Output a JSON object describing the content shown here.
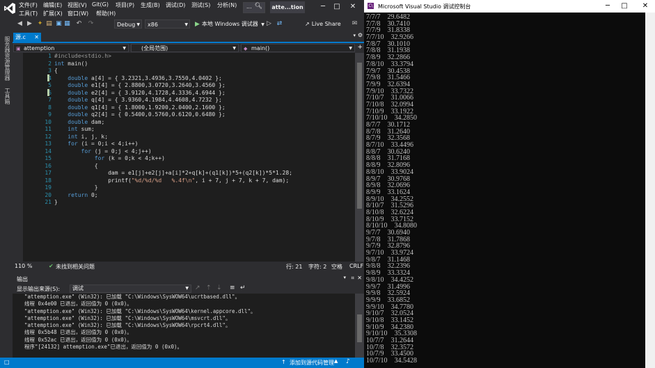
{
  "vs": {
    "menu_row1": [
      "文件(F)",
      "编辑(E)",
      "视图(V)",
      "Git(G)",
      "项目(P)",
      "生成(B)",
      "调试(D)",
      "测试(S)",
      "分析(N)"
    ],
    "menu_row2": [
      "工具(T)",
      "扩展(X)",
      "窗口(W)",
      "帮助(H)"
    ],
    "search_label": "...",
    "title": "atte...tion",
    "toolbar": {
      "config": "Debug",
      "platform": "x86",
      "run_label": "本地 Windows 调试器",
      "live_share": "Live Share"
    },
    "side_tabs": [
      "服务器资源管理器",
      "工具箱"
    ],
    "file_tab": "源.c",
    "nav": {
      "project": "attemption",
      "scope": "(全局范围)",
      "function": "main()"
    },
    "code_lines": [
      "#include<stdio.h>",
      "int main()",
      "{",
      "    double a[4] = { 3.2321,3.4936,3.7550,4.0402 };",
      "    double e1[4] = { 2.8800,3.0720,3.2640,3.4560 };",
      "    double e2[4] = { 3.9120,4.1728,4.3336,4.6944 };",
      "    double q[4] = { 3.9360,4.1984,4.4608,4.7232 };",
      "    double q1[4] = { 1.8000,1.9200,2.0400,2.1600 };",
      "    double q2[4] = { 0.5400,0.5760,0.6120,0.6480 };",
      "    double dam;",
      "    int sum;",
      "    int i, j, k;",
      "    for (i = 0;i < 4;i++)",
      "        for (j = 0;j < 4;j++)",
      "            for (k = 0;k < 4;k++)",
      "            {",
      "                dam = e1[j]+e2[j]+a[i]*2+q[k]+(q1[k])*5+(q2[k])*5*1.28;",
      "                printf(\"%d/%d/%d   %.4f\\n\", i + 7, j + 7, k + 7, dam);",
      "            }",
      "    return 0;",
      "}"
    ],
    "status": {
      "zoom": "110 %",
      "issues": "未找到相关问题",
      "line": "行: 21",
      "char": "字符: 2",
      "ws": "空格",
      "eol": "CRLF"
    },
    "output": {
      "title": "输出",
      "source_label": "显示输出来源(S):",
      "source_value": "调试",
      "lines": [
        "  \"attemption.exe\" (Win32): 已加载 \"C:\\Windows\\SysWOW64\\ucrtbased.dll\"。",
        "  线程 0x4e00 已退出，返回值为 0 (0x0)。",
        "  \"attemption.exe\" (Win32): 已加载 \"C:\\Windows\\SysWOW64\\kernel.appcore.dll\"。",
        "  \"attemption.exe\" (Win32): 已加载 \"C:\\Windows\\SysWOW64\\msvcrt.dll\"。",
        "  \"attemption.exe\" (Win32): 已加载 \"C:\\Windows\\SysWOW64\\rpcrt4.dll\"。",
        "  线程 0x5b48 已退出，返回值为 0 (0x0)。",
        "  线程 0x52ac 已退出，返回值为 0 (0x0)。",
        "  程序\"[24132] attemption.exe\"已退出，返回值为 0 (0x0)。"
      ]
    },
    "bottom_bar": {
      "source_control": "添加到源代码管理"
    }
  },
  "console": {
    "title": "Microsoft Visual Studio 调试控制台",
    "lines": [
      "7/7/7    29.6482",
      "7/7/8    30.7410",
      "7/7/9    31.8338",
      "7/7/10    32.9266",
      "7/8/7    30.1010",
      "7/8/8    31.1938",
      "7/8/9    32.2866",
      "7/8/10    33.3794",
      "7/9/7    30.4538",
      "7/9/8    31.5466",
      "7/9/9    32.6394",
      "7/9/10    33.7322",
      "7/10/7    31.0066",
      "7/10/8    32.0994",
      "7/10/9    33.1922",
      "7/10/10    34.2850",
      "8/7/7    30.1712",
      "8/7/8    31.2640",
      "8/7/9    32.3568",
      "8/7/10    33.4496",
      "8/8/7    30.6240",
      "8/8/8    31.7168",
      "8/8/9    32.8096",
      "8/8/10    33.9024",
      "8/9/7    30.9768",
      "8/9/8    32.0696",
      "8/9/9    33.1624",
      "8/9/10    34.2552",
      "8/10/7    31.5296",
      "8/10/8    32.6224",
      "8/10/9    33.7152",
      "8/10/10    34.8080",
      "9/7/7    30.6940",
      "9/7/8    31.7868",
      "9/7/9    32.8796",
      "9/7/10    33.9724",
      "9/8/7    31.1468",
      "9/8/8    32.2396",
      "9/8/9    33.3324",
      "9/8/10    34.4252",
      "9/9/7    31.4996",
      "9/9/8    32.5924",
      "9/9/9    33.6852",
      "9/9/10    34.7780",
      "9/10/7    32.0524",
      "9/10/8    33.1452",
      "9/10/9    34.2380",
      "9/10/10    35.3308",
      "10/7/7    31.2644",
      "10/7/8    32.3572",
      "10/7/9    33.4500",
      "10/7/10    34.5428"
    ]
  }
}
